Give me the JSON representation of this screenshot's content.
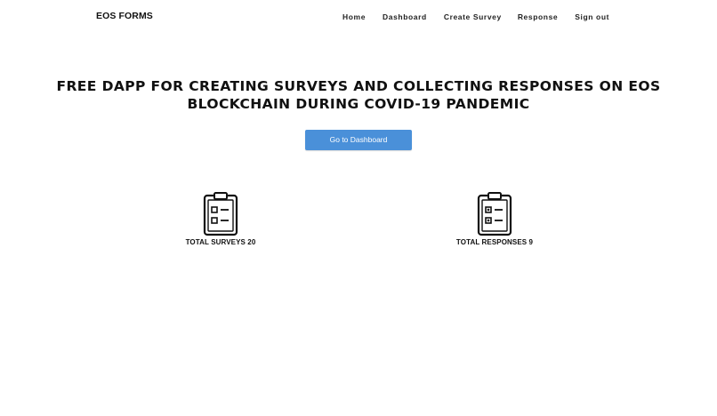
{
  "navbar": {
    "brand": "EOS FORMS",
    "links": [
      "Home",
      "Dashboard",
      "Create Survey",
      "Response",
      "Sign out"
    ]
  },
  "hero": {
    "title_line1": "FREE DAPP FOR CREATING SURVEYS AND COLLECTING RESPONSES ON EOS",
    "title_line2": "BLOCKCHAIN DURING COVID-19 PANDEMIC",
    "cta_label": "Go to Dashboard"
  },
  "stats": [
    {
      "icon": "clipboard-checklist-icon",
      "label": "TOTAL SURVEYS 20"
    },
    {
      "icon": "clipboard-checklist-icon",
      "label": "TOTAL RESPONSES 9"
    }
  ],
  "colors": {
    "accent": "#4a90d9",
    "text": "#111111",
    "background": "#ffffff"
  }
}
